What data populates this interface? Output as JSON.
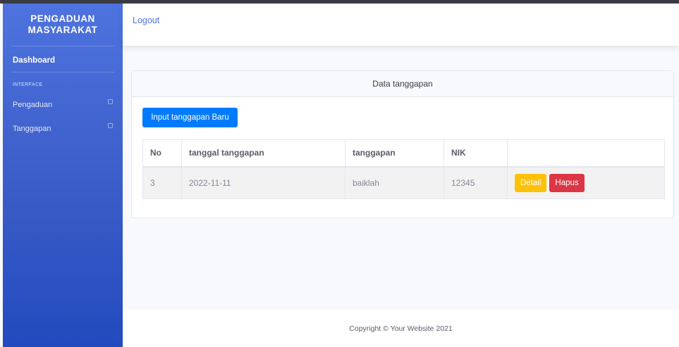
{
  "sidebar": {
    "brand_line1": "PENGADUAN",
    "brand_line2": "MASYARAKAT",
    "dashboard": "Dashboard",
    "section_heading": "INTERFACE",
    "items": [
      {
        "label": "Pengaduan"
      },
      {
        "label": "Tanggapan"
      }
    ]
  },
  "topbar": {
    "logout": "Logout"
  },
  "card": {
    "title": "Data tanggapan",
    "new_button": "Input tanggapan Baru",
    "columns": [
      "No",
      "tanggal tanggapan",
      "tanggapan",
      "NIK",
      ""
    ],
    "rows": [
      {
        "no": "3",
        "tanggal": "2022-11-11",
        "tanggapan": "baiklah",
        "nik": "12345",
        "detail": "Detail",
        "hapus": "Hapus"
      }
    ]
  },
  "footer": {
    "copyright": "Copyright © Your Website 2021"
  },
  "colors": {
    "primary": "#4e73df",
    "button_blue": "#007bff",
    "warning": "#ffc107",
    "danger": "#dc3545"
  }
}
